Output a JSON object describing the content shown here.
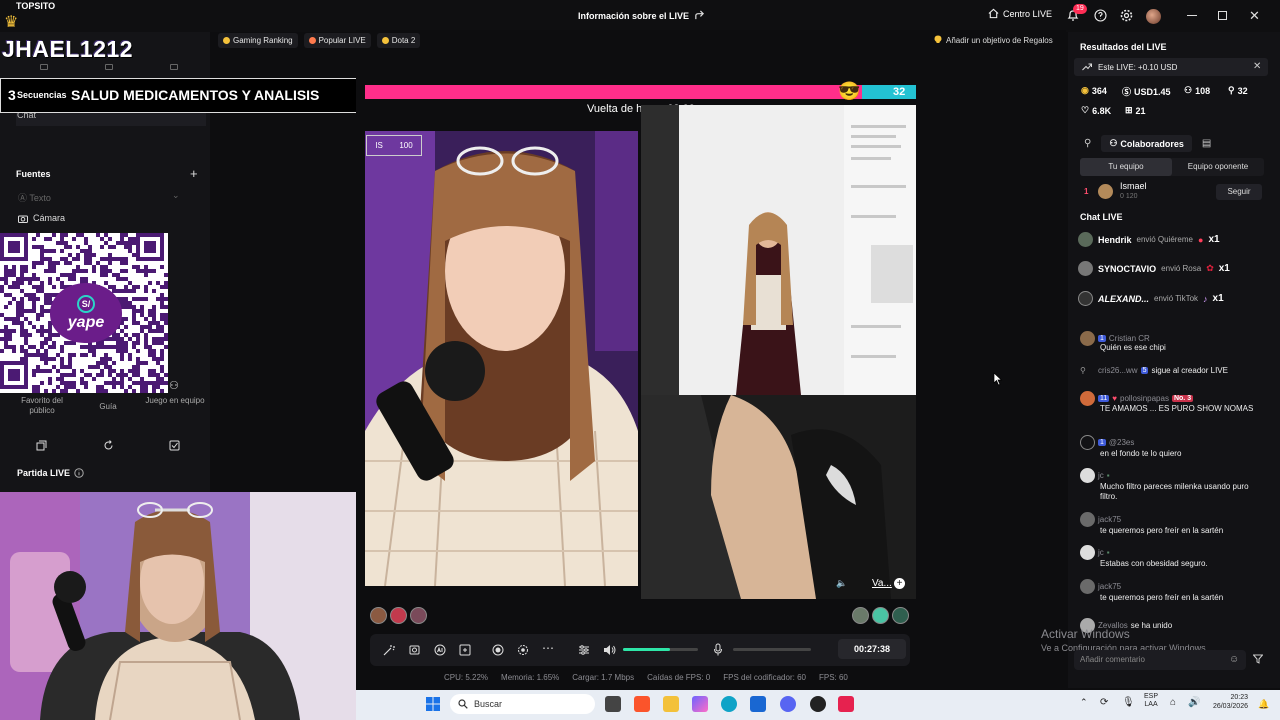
{
  "topbar": {
    "brand": "TOPSITO",
    "window_title": "Información sobre el LIVE",
    "centro_live": "Centro LIVE",
    "notif_count": "19"
  },
  "left": {
    "channel_name": "JHAEL1212",
    "banner_number": "3",
    "banner_sequence": "Secuencias",
    "banner_title": "SALUD MEDICAMENTOS Y ANALISIS",
    "banner_counter": "100",
    "chat_source": "Chat",
    "fuentes": "Fuentes",
    "texto": "Texto",
    "camara": "Cámara",
    "options": [
      "Favorito del público",
      "Guía",
      "Juego en equipo"
    ],
    "partida": "Partida LIVE",
    "qr_brand": "yape",
    "qr_badge": "S/"
  },
  "stage": {
    "chips": [
      {
        "label": "Gaming Ranking",
        "dot": "#f5c23b"
      },
      {
        "label": "Popular LIVE",
        "dot": "#ff7a4d"
      },
      {
        "label": "Dota 2",
        "dot": "#f5c23b"
      }
    ],
    "goal_link": "Añadir un objetivo de Regalos",
    "score_right": "32",
    "honor_lap": "Vuelta de honor 03:00",
    "left_tag_a": "IS",
    "left_tag_b": "100",
    "br_label": "Va...",
    "timer": "00:27:38",
    "volume_level": 0.62,
    "stats": [
      "CPU: 5.22%",
      "Memoria: 1.65%",
      "Cargar: 1.7 Mbps",
      "Caídas de FPS: 0",
      "FPS del codificador: 60",
      "FPS: 60"
    ]
  },
  "right": {
    "results_title": "Resultados del LIVE",
    "este_live": "Este LIVE: +0.10 USD",
    "stats": [
      {
        "icon": "coin",
        "value": "364"
      },
      {
        "icon": "dollar",
        "value": "USD1.45"
      },
      {
        "icon": "users",
        "value": "108"
      },
      {
        "icon": "person",
        "value": "32"
      },
      {
        "icon": "heart",
        "value": "6.8K"
      },
      {
        "icon": "gift",
        "value": "21"
      }
    ],
    "collab": "Colaboradores",
    "team_tabs": [
      "Tu equipo",
      "Equipo oponente"
    ],
    "rank_num": "1",
    "rank_name": "Ismael",
    "rank_sub": "0  120",
    "follow": "Seguir",
    "chat_title": "Chat LIVE",
    "gifts": [
      {
        "name": "Hendrik",
        "text": "envió Quiéreme",
        "count": "x1"
      },
      {
        "name": "SYNOCTAVIO",
        "text": "envió Rosa",
        "count": "x1"
      },
      {
        "name": "ALEXAND...",
        "text": "envió TikTok",
        "count": "x1"
      }
    ],
    "messages": [
      {
        "user": "Cristian CR",
        "level": "1",
        "text": "Quién es ese chipi"
      },
      {
        "user": "cris26...ww",
        "level": "5",
        "text": "sigue al creador LIVE",
        "inline": true
      },
      {
        "user": "pollosinpapas",
        "level": "11",
        "rank": "No. 3",
        "text": "TE AMAMOS ... ES PURO SHOW NOMAS"
      },
      {
        "user": "@23es",
        "level": "1",
        "text": "en el fondo te lo quiero"
      },
      {
        "user": "jc",
        "level": "",
        "text": "Mucho filtro pareces milenka usando puro filtro."
      },
      {
        "user": "jack75",
        "level": "",
        "text": "te queremos pero freír en la sartén"
      },
      {
        "user": "jc",
        "level": "",
        "text": "Estabas con obesidad seguro."
      },
      {
        "user": "jack75",
        "level": "",
        "text": "te queremos pero freír en la sartén"
      },
      {
        "user": "Zevallos",
        "level": "",
        "text": "se ha unido",
        "inline": true
      }
    ],
    "watermark_title": "Activar Windows",
    "watermark_sub": "Ve a Configuración para activar Windows.",
    "comment_placeholder": "Añadir comentario"
  },
  "taskbar": {
    "search": "Buscar",
    "lang_1": "ESP",
    "lang_2": "LAA",
    "time": "20:23",
    "date": "26/03/2026"
  },
  "colors": {
    "accent_pink": "#ff2e8a",
    "accent_cyan": "#23c2d3",
    "level_blue": "#3f5bd9"
  }
}
